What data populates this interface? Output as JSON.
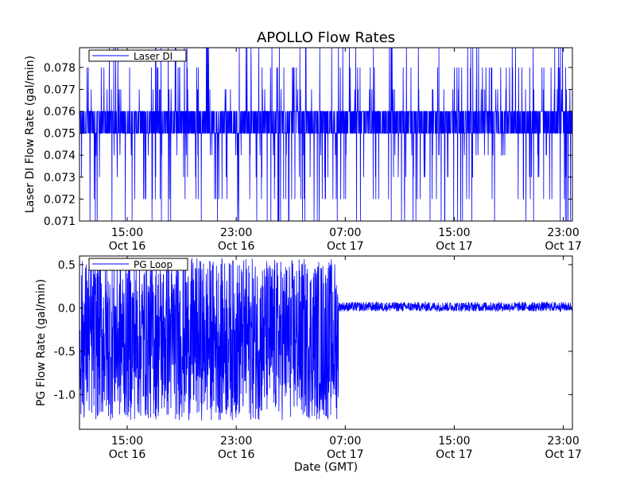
{
  "figure": {
    "title": "APOLLO Flow Rates",
    "xlabel": "Date (GMT)"
  },
  "chart_data": [
    {
      "type": "line",
      "ylabel": "Laser DI Flow Rate (gal/min)",
      "ylim": [
        0.071,
        0.0789
      ],
      "yticks": [
        "0.071",
        "0.072",
        "0.073",
        "0.074",
        "0.075",
        "0.076",
        "0.077",
        "0.078"
      ],
      "ytick_values": [
        0.071,
        0.072,
        0.073,
        0.074,
        0.075,
        0.076,
        0.077,
        0.078
      ],
      "xlim": [
        "Oct 16 11:30",
        "Oct 17 23:40"
      ],
      "xticks": [
        {
          "time": "15:00",
          "date": "Oct 16"
        },
        {
          "time": "23:00",
          "date": "Oct 16"
        },
        {
          "time": "07:00",
          "date": "Oct 17"
        },
        {
          "time": "15:00",
          "date": "Oct 17"
        },
        {
          "time": "23:00",
          "date": "Oct 17"
        }
      ],
      "grid": false,
      "legend_position": "top-left",
      "series": [
        {
          "name": "Laser DI",
          "color": "#0000ff",
          "typical_range": [
            0.075,
            0.076
          ],
          "spike_range": [
            0.0705,
            0.0789
          ]
        }
      ]
    },
    {
      "type": "line",
      "ylabel": "PG Flow Rate (gal/min)",
      "ylim": [
        -1.4,
        0.6
      ],
      "yticks": [
        "0.5",
        "0.0",
        "-0.5",
        "-1.0"
      ],
      "ytick_values": [
        0.5,
        0.0,
        -0.5,
        -1.0
      ],
      "xlim": [
        "Oct 16 11:30",
        "Oct 17 23:40"
      ],
      "xticks": [
        {
          "time": "15:00",
          "date": "Oct 16"
        },
        {
          "time": "23:00",
          "date": "Oct 16"
        },
        {
          "time": "07:00",
          "date": "Oct 17"
        },
        {
          "time": "15:00",
          "date": "Oct 17"
        },
        {
          "time": "23:00",
          "date": "Oct 17"
        }
      ],
      "grid": false,
      "legend_position": "top-left",
      "series": [
        {
          "name": "PG Loop",
          "color": "#0000ff",
          "noisy_segment": {
            "end": "Oct 17 06:30",
            "range": [
              -1.3,
              0.58
            ]
          },
          "steady_segment": {
            "start": "Oct 17 06:30",
            "range": [
              -0.04,
              0.07
            ]
          }
        }
      ]
    }
  ]
}
